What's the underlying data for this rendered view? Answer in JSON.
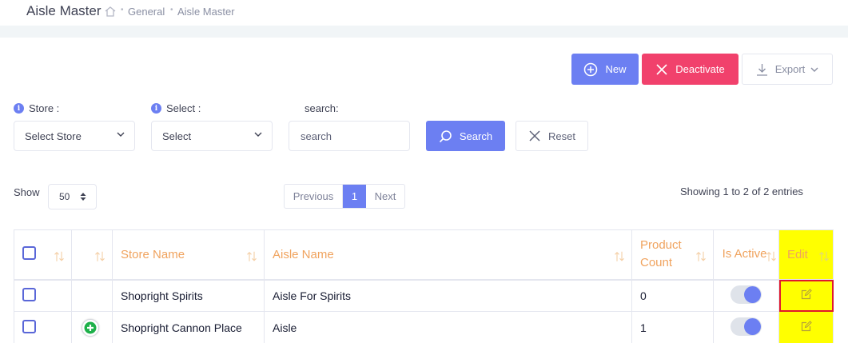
{
  "header": {
    "title": "Aisle Master",
    "breadcrumb": [
      "General",
      "Aisle Master"
    ]
  },
  "actions": {
    "new_label": "New",
    "deactivate_label": "Deactivate",
    "export_label": "Export"
  },
  "filters": {
    "store_label": "Store :",
    "store_value": "Select Store",
    "select_label": "Select :",
    "select_value": "Select",
    "search_label": "search:",
    "search_placeholder": "search",
    "search_button": "Search",
    "reset_button": "Reset"
  },
  "paging": {
    "show_label": "Show",
    "page_size": "50",
    "previous": "Previous",
    "current_page": "1",
    "next": "Next",
    "showing_text": "Showing 1 to 2 of 2 entries"
  },
  "table": {
    "columns": [
      "",
      "",
      "Store Name",
      "Aisle Name",
      "Product Count",
      "Is Active",
      "Edit"
    ],
    "rows": [
      {
        "store": "Shopright Spirits",
        "aisle": "Aisle For Spirits",
        "count": "0",
        "active": true
      },
      {
        "store": "Shopright Cannon Place",
        "aisle": "Aisle",
        "count": "1",
        "active": true
      }
    ]
  },
  "colors": {
    "primary": "#6c7ff2",
    "danger": "#f1416c",
    "header_text": "#f0a35e",
    "highlight": "#ffff00",
    "highlight_border": "#e0182d"
  }
}
